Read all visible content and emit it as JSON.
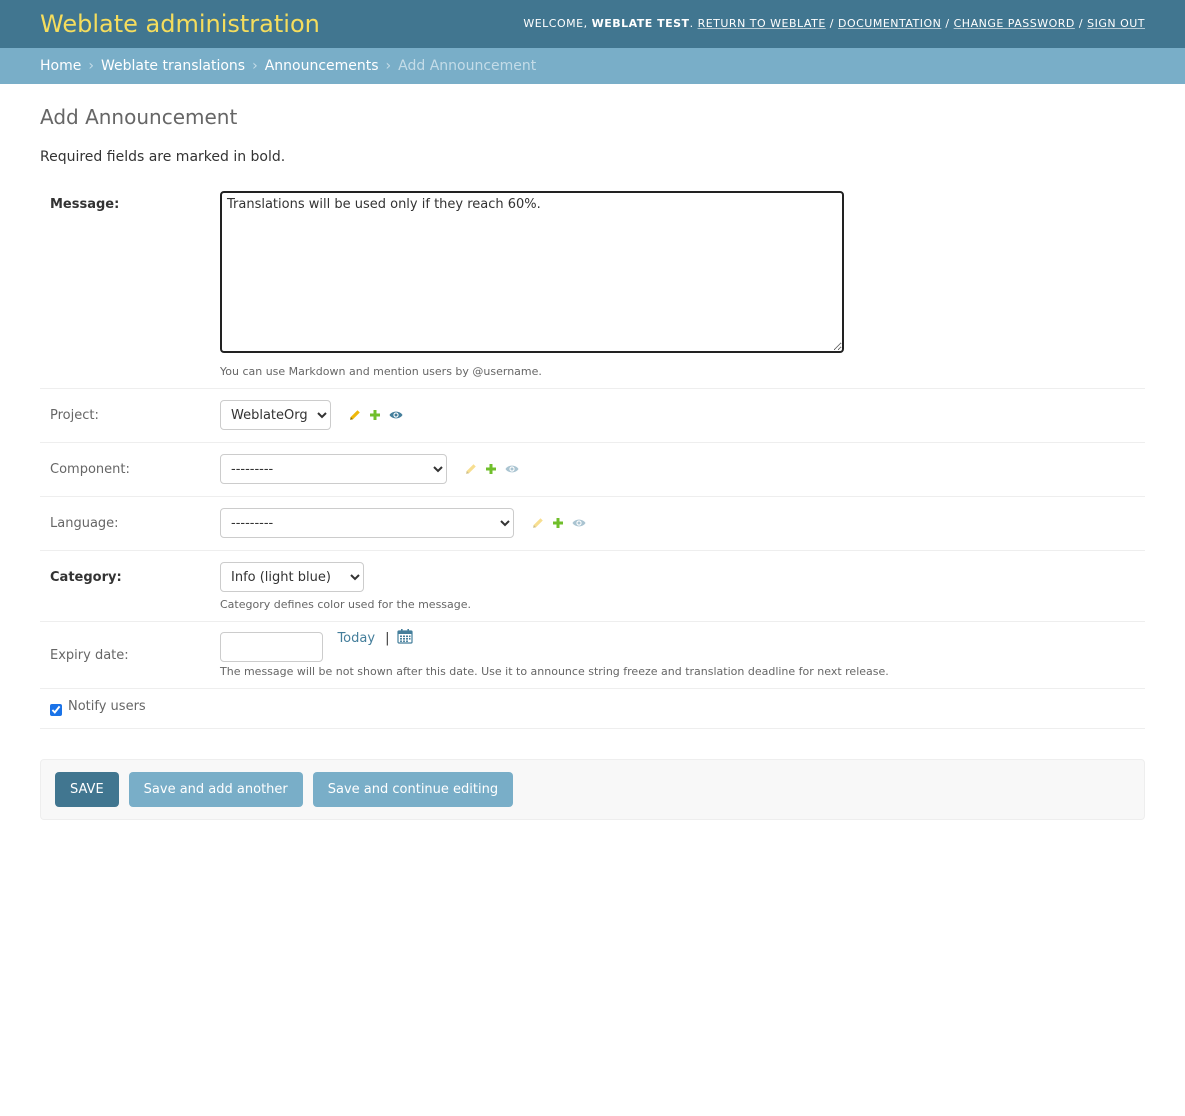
{
  "header": {
    "branding": "Weblate administration",
    "welcome": "Welcome,",
    "username": "Weblate Test",
    "links": [
      "Return to Weblate",
      "Documentation",
      "Change password",
      "Sign out"
    ]
  },
  "breadcrumbs": {
    "items": [
      "Home",
      "Weblate translations",
      "Announcements"
    ],
    "current": "Add Announcement"
  },
  "page": {
    "title": "Add Announcement",
    "note": "Required fields are marked in bold."
  },
  "form": {
    "message": {
      "label": "Message:",
      "value": "Translations will be used only if they reach 60%.",
      "help": "You can use Markdown and mention users by @username."
    },
    "project": {
      "label": "Project:",
      "selected": "WeblateOrg"
    },
    "component": {
      "label": "Component:",
      "selected": "---------"
    },
    "language": {
      "label": "Language:",
      "selected": "---------"
    },
    "category": {
      "label": "Category:",
      "selected": "Info (light blue)",
      "help": "Category defines color used for the message."
    },
    "expiry": {
      "label": "Expiry date:",
      "value": "",
      "today": "Today",
      "separator": "|",
      "help": "The message will be not shown after this date. Use it to announce string freeze and translation deadline for next release."
    },
    "notify": {
      "label": "Notify users",
      "checked": true
    }
  },
  "buttons": {
    "save": "Save",
    "save_add": "Save and add another",
    "save_continue": "Save and continue editing"
  },
  "colors": {
    "header": "#417690",
    "branding": "#f5dd5d",
    "breadcrumbs": "#79aec8",
    "pencil": "#efb80b",
    "plus": "#70bf2b",
    "eye": "#447e9b"
  },
  "icons": {
    "change": "pencil-icon",
    "add": "plus-icon",
    "view": "eye-icon",
    "calendar": "calendar-icon"
  }
}
